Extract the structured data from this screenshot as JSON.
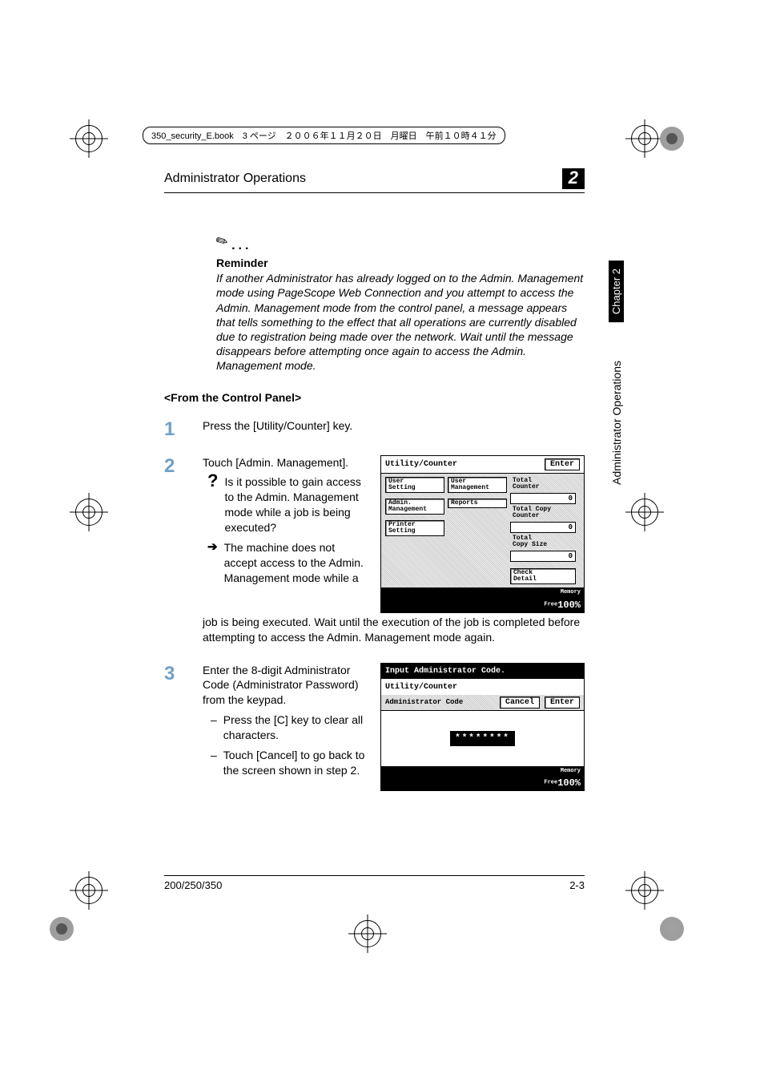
{
  "doc": {
    "file_header": "350_security_E.book　3 ページ　２００６年１１月２０日　月曜日　午前１０時４１分",
    "header_title": "Administrator Operations",
    "chapter_num": "2",
    "side_chapter": "Chapter 2",
    "side_section": "Administrator Operations",
    "footer_left": "200/250/350",
    "footer_right": "2-3"
  },
  "reminder": {
    "label": "Reminder",
    "body": "If another Administrator has already logged on to the Admin. Management mode using PageScope Web Connection and you attempt to access the Admin. Management mode from the control panel, a message appears that tells something to the effect that all operations are currently disabled due to registration being made over the network. Wait until the message disappears before attempting once again to access the Admin. Management mode."
  },
  "section_heading": "<From the Control Panel>",
  "steps": {
    "s1": {
      "num": "1",
      "text": "Press the [Utility/Counter] key."
    },
    "s2": {
      "num": "2",
      "text": "Touch [Admin. Management].",
      "q": "Is it possible to gain access to the Admin. Management mode while a job is being executed?",
      "a1": "The machine does not accept access to the Admin. Management mode while a",
      "a_cont": "job is being executed. Wait until the execution of the job is completed before attempting to access the Admin. Management mode again."
    },
    "s3": {
      "num": "3",
      "text": "Enter the 8-digit Administrator Code (Administrator Password) from the keypad.",
      "d1": "Press the [C] key to clear all characters.",
      "d2": "Touch [Cancel] to go back to the screen shown in step 2."
    }
  },
  "lcd1": {
    "title": "Utility/Counter",
    "enter": "Enter",
    "user_setting": "User\nSetting",
    "user_mgmt": "User\nManagement",
    "admin_mgmt": "Admin.\nManagement",
    "reports": "Reports",
    "printer_setting": "Printer\nSetting",
    "total_counter": "Total\nCounter",
    "total_counter_val": "0",
    "total_copy_counter": "Total Copy\nCounter",
    "total_copy_counter_val": "0",
    "total_copy_size": "Total\nCopy Size",
    "total_copy_size_val": "0",
    "check_detail": "Check\nDetail",
    "memory": "Memory\nFree",
    "memory_pct": "100%"
  },
  "lcd2": {
    "title_prefix": "Input ",
    "title_main": "Administrator Code.",
    "sub": "Utility/Counter",
    "label": "Administrator Code",
    "cancel": "Cancel",
    "enter": "Enter",
    "code": "********",
    "memory": "Memory\nFree",
    "memory_pct": "100%"
  }
}
